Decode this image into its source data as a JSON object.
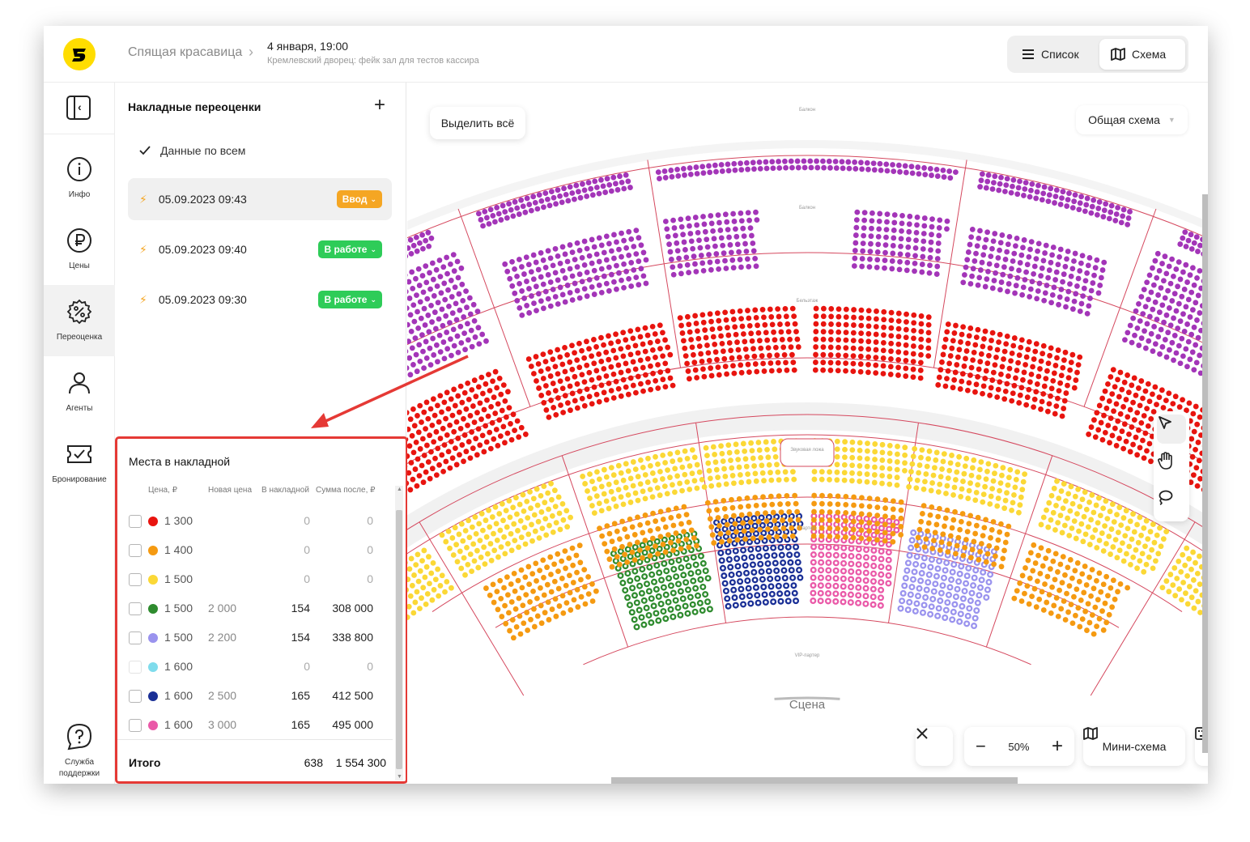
{
  "header": {
    "event_name": "Спящая красавица",
    "event_date": "4 января, 19:00",
    "venue": "Кремлевский дворец: фейк зал для тестов кассира",
    "view_list_label": "Список",
    "view_scheme_label": "Схема"
  },
  "nav": {
    "items": [
      {
        "label": "Инфо",
        "icon": "info-icon"
      },
      {
        "label": "Цены",
        "icon": "ruble-icon"
      },
      {
        "label": "Переоценка",
        "icon": "percent-icon",
        "active": true
      },
      {
        "label": "Агенты",
        "icon": "user-icon"
      },
      {
        "label": "Бронирование",
        "icon": "ticket-check-icon"
      }
    ],
    "support_label": "Служба\nподдержки"
  },
  "panel": {
    "title": "Накладные переоценки",
    "all_data_label": "Данные по всем",
    "invoices": [
      {
        "date": "05.09.2023 09:43",
        "status": "Ввод",
        "status_color": "#f5a623",
        "selected": true
      },
      {
        "date": "05.09.2023 09:40",
        "status": "В работе",
        "status_color": "#2ecc58",
        "selected": false
      },
      {
        "date": "05.09.2023 09:30",
        "status": "В работе",
        "status_color": "#2ecc58",
        "selected": false
      }
    ]
  },
  "seats": {
    "title": "Места в накладной",
    "columns": [
      "Цена, ₽",
      "Новая цена",
      "В накладной",
      "Сумма после, ₽"
    ],
    "rows": [
      {
        "color": "#e8140f",
        "price": "1 300",
        "new_price": "",
        "count": "0",
        "sum": "0"
      },
      {
        "color": "#f59a11",
        "price": "1 400",
        "new_price": "",
        "count": "0",
        "sum": "0"
      },
      {
        "color": "#fbd836",
        "price": "1 500",
        "new_price": "",
        "count": "0",
        "sum": "0"
      },
      {
        "color": "#2e8b2e",
        "price": "1 500",
        "new_price": "2 000",
        "count": "154",
        "sum": "308 000"
      },
      {
        "color": "#9a93ee",
        "price": "1 500",
        "new_price": "2 200",
        "count": "154",
        "sum": "338 800"
      },
      {
        "color": "#7fdcec",
        "price": "1 600",
        "new_price": "",
        "count": "0",
        "sum": "0",
        "disabled": true
      },
      {
        "color": "#1a2f96",
        "price": "1 600",
        "new_price": "2 500",
        "count": "165",
        "sum": "412 500"
      },
      {
        "color": "#ea59a8",
        "price": "1 600",
        "new_price": "3 000",
        "count": "165",
        "sum": "495 000"
      }
    ],
    "total_label": "Итого",
    "total_count": "638",
    "total_sum": "1 554 300"
  },
  "map": {
    "select_all_label": "Выделить всё",
    "scheme_select_label": "Общая схема",
    "stage_label": "Сцена",
    "sections": {
      "balcony": "Балкон",
      "beletage": "Бельэтаж",
      "sound_box": "Звуковая ложа",
      "parterre": "Партер",
      "vip_parterre": "VIP-партер"
    },
    "zoom_label": "50%",
    "minimap_label": "Мини-схема"
  }
}
